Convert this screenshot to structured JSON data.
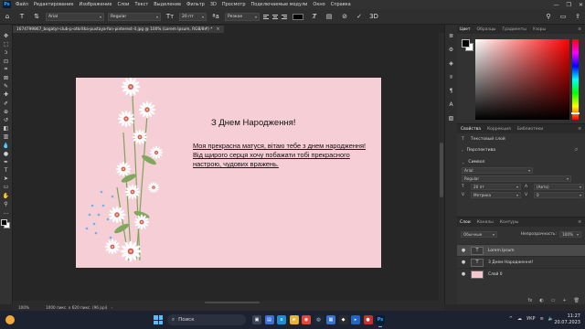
{
  "app": {
    "logo": "Ps",
    "menu": [
      "Файл",
      "Редактирование",
      "Изображение",
      "Слои",
      "Текст",
      "Выделение",
      "Фильтр",
      "3D",
      "Просмотр",
      "Подключаемые модули",
      "Окно",
      "Справка"
    ],
    "window_controls": [
      "—",
      "❐",
      "✕"
    ]
  },
  "options_bar": {
    "font_family": "Arial",
    "font_style": "Regular",
    "font_size": "20 пт",
    "aa_icon": "ªa",
    "antialias": "Резкое",
    "text_color": "#000000"
  },
  "document": {
    "tab_title": "1674799867_bogatyr-club-p-otkritka-pustaya-fon-pinterest-4.jpg @ 100% (Lorem Ipsum, RGB/8#) *",
    "tab_close": "×",
    "card_title": "З Днем Народження!",
    "card_body": "Моя прекрасна матуся, вітаю тебе з днем народження! Від щирого серця хочу побажати тобі прекрасного настрою, чудових вражень."
  },
  "status": {
    "zoom": "100%",
    "doc_info": "1000 пикс. x 620 пикс. (96 ppi)",
    "arrow": "›"
  },
  "color_panel": {
    "tabs": [
      "Цвет",
      "Образцы",
      "Градиенты",
      "Узоры"
    ],
    "active_tab": 0,
    "foreground": "#000000",
    "background": "#ffffff"
  },
  "properties_panel": {
    "tabs": [
      "Свойства",
      "Коррекция",
      "Библиотеки"
    ],
    "active_tab": 0,
    "layer_type": "Текстовый слой",
    "transform_label": "Перспектива",
    "character_label": "Символ",
    "font_family": "Arial",
    "font_style": "Regular",
    "size": "20 пт",
    "leading": "(Авто)",
    "tracking_method": "Метрика",
    "tracking": "0"
  },
  "layers_panel": {
    "tabs": [
      "Слои",
      "Каналы",
      "Контуры"
    ],
    "active_tab": 0,
    "blend_mode": "Обычные",
    "opacity_label": "Непрозрачность:",
    "opacity": "100%",
    "layers": [
      {
        "name": "Lorem Ipsum",
        "type": "text",
        "selected": true
      },
      {
        "name": "З Днем Народження!",
        "type": "text",
        "selected": false
      },
      {
        "name": "Слой 0",
        "type": "image",
        "selected": false
      }
    ],
    "text_thumb": "T",
    "eye": "●",
    "bottom_icons": [
      "fx",
      "◐",
      "▭",
      "+",
      "🗑"
    ]
  },
  "taskbar": {
    "search_placeholder": "Поиск",
    "search_icon": "⌕",
    "tray_lang": "УКР",
    "tray_caret": "^",
    "time": "11:27",
    "date": "20.07.2023",
    "apps": [
      {
        "name": "task-view",
        "glyph": "▣",
        "color": "#3a4256"
      },
      {
        "name": "files",
        "glyph": "▤",
        "color": "#3d6fd8"
      },
      {
        "name": "edge",
        "glyph": "e",
        "color": "#1a8fd6"
      },
      {
        "name": "explorer",
        "glyph": "▰",
        "color": "#e7b436"
      },
      {
        "name": "chrome",
        "glyph": "◉",
        "color": "#e0463c"
      },
      {
        "name": "steam",
        "glyph": "◎",
        "color": "#1b2838"
      },
      {
        "name": "store",
        "glyph": "▦",
        "color": "#3672d6"
      },
      {
        "name": "app-dark",
        "glyph": "◆",
        "color": "#2b2b2b"
      },
      {
        "name": "app-blue",
        "glyph": "▸",
        "color": "#2264c8"
      },
      {
        "name": "app-red",
        "glyph": "●",
        "color": "#c8312b"
      },
      {
        "name": "photoshop",
        "glyph": "Ps",
        "color": "#001e36"
      }
    ]
  },
  "toolbar": {
    "tools": [
      "move",
      "marquee",
      "lasso",
      "object-select",
      "crop",
      "frame",
      "eyedropper",
      "healing",
      "brush",
      "stamp",
      "history-brush",
      "eraser",
      "gradient",
      "blur",
      "dodge",
      "pen",
      "type",
      "path-select",
      "rectangle",
      "hand",
      "zoom",
      "more"
    ],
    "glyphs": [
      "✥",
      "⬚",
      "ↄ",
      "⊡",
      "⌗",
      "⊠",
      "✎",
      "✚",
      "✐",
      "⊕",
      "↺",
      "◧",
      "▥",
      "💧",
      "●",
      "✒",
      "T",
      "➤",
      "▭",
      "✋",
      "⚲",
      "…"
    ]
  },
  "icon_strip": {
    "glyphs": [
      "≣",
      "⚙",
      "◈",
      "⌾",
      "¶",
      "A",
      "▧"
    ]
  }
}
